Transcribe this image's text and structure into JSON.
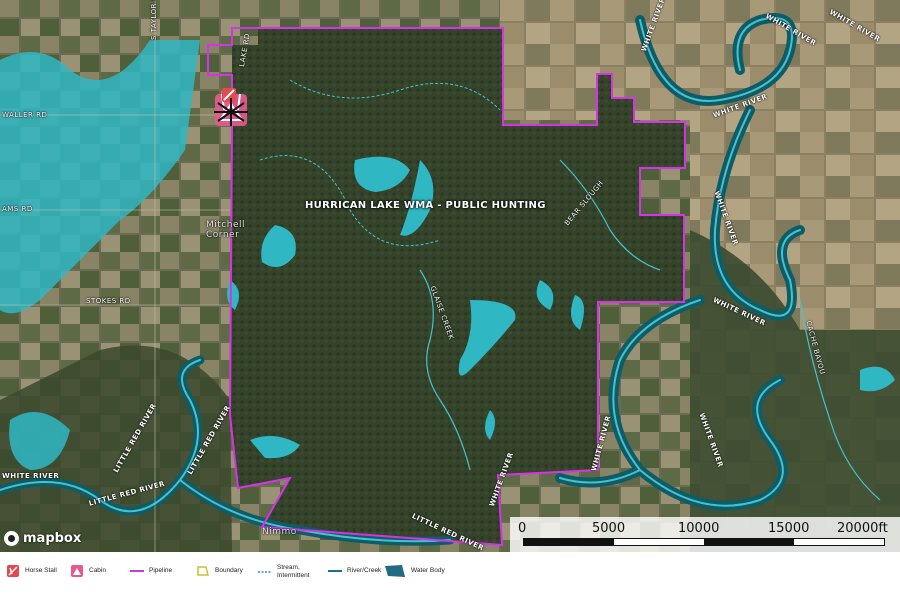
{
  "map": {
    "title": "HURRICAN LAKE WMA - PUBLIC HUNTING",
    "places": {
      "mitchell_corner": "Mitchell\nCorner",
      "nimmo": "Nimmo"
    },
    "roads": {
      "s_taylor_rd": "S TAYLOR RD",
      "waller_rd": "WALLER RD",
      "ams_rd": "AMS RD",
      "stokes_rd": "STOKES RD",
      "lake_rd": "LAKE RD"
    },
    "rivers": {
      "white_river": "WHITE RIVER",
      "little_red_river": "LITTLE RED RIVER",
      "glaise_creek": "GLAISE CREEK",
      "bear_slough": "BEAR SLOUGH",
      "cache_bayou": "CACHE BAYOU"
    },
    "colors": {
      "boundary": "#d633e8",
      "water": "#2fb7c4",
      "stream": "#44c3cf",
      "horse_stall": "#e5484d",
      "cabin": "#e85a8f"
    }
  },
  "scalebar": {
    "ticks": [
      "0",
      "5000",
      "10000",
      "15000",
      "20000ft"
    ]
  },
  "attribution": {
    "logo_text": "mapbox"
  },
  "legend": {
    "items": [
      {
        "label": "Horse Stall",
        "icon": "horse-stall-icon"
      },
      {
        "label": "Cabin",
        "icon": "cabin-icon"
      },
      {
        "label": "Pipeline",
        "icon": "pipeline-line"
      },
      {
        "label": "Boundary",
        "icon": "boundary-polygon"
      },
      {
        "label": "Stream, Intermittent",
        "icon": "stream-dashed-line"
      },
      {
        "label": "River/Creek",
        "icon": "river-line"
      },
      {
        "label": "Water Body",
        "icon": "water-body-polygon"
      }
    ]
  }
}
